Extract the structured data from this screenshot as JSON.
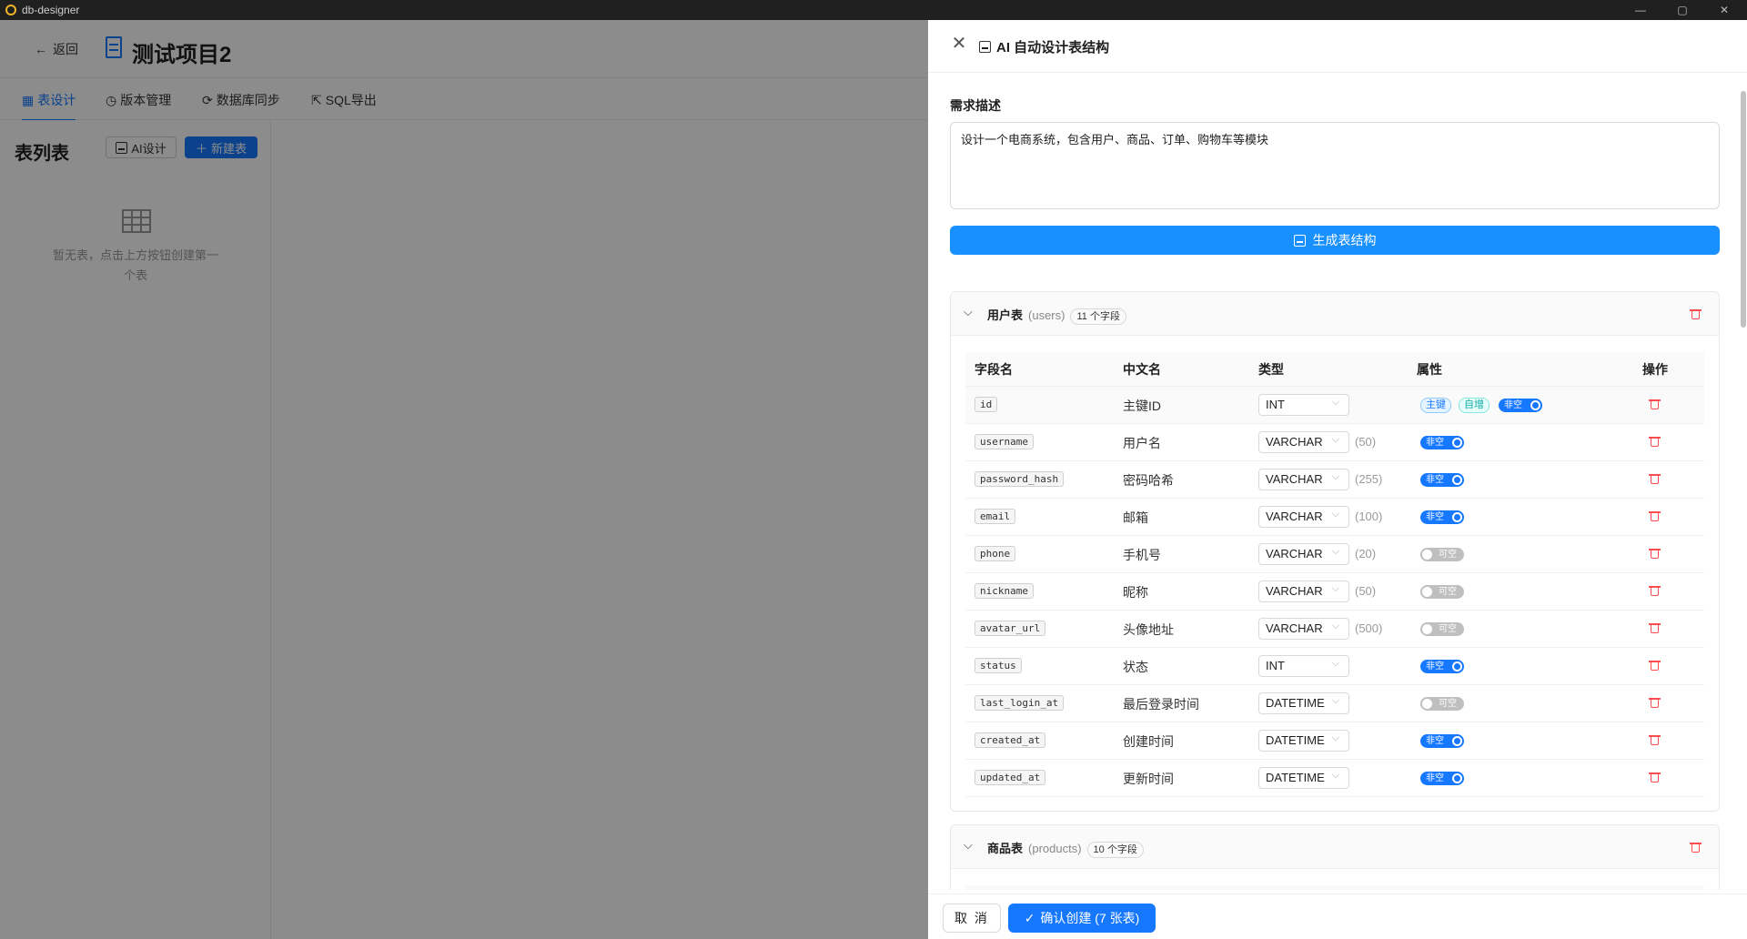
{
  "window": {
    "title": "db-designer",
    "min": "—",
    "max": "▢",
    "close": "✕"
  },
  "header": {
    "back_label": "返回",
    "project_title": "测试项目2"
  },
  "tabs": [
    {
      "label": "表设计",
      "icon": "table-icon"
    },
    {
      "label": "版本管理",
      "icon": "history-icon"
    },
    {
      "label": "数据库同步",
      "icon": "sync-icon"
    },
    {
      "label": "SQL导出",
      "icon": "export-icon"
    }
  ],
  "sidebar": {
    "title": "表列表",
    "ai_button": "AI设计",
    "new_button": "新建表",
    "empty_text": "暂无表，点击上方按钮创建第一个表"
  },
  "drawer": {
    "title": "AI 自动设计表结构",
    "requirement_label": "需求描述",
    "requirement_value": "设计一个电商系统，包含用户、商品、订单、购物车等模块",
    "generate_button": "生成表结构",
    "columns": [
      "字段名",
      "中文名",
      "类型",
      "属性",
      "操作"
    ],
    "tables": [
      {
        "name": "用户表",
        "code": "(users)",
        "count": "11 个字段",
        "fields": [
          {
            "name": "id",
            "cn": "主键ID",
            "type": "INT",
            "len": "",
            "pk": "主键",
            "ai": "自增",
            "nullable": false
          },
          {
            "name": "username",
            "cn": "用户名",
            "type": "VARCHAR",
            "len": "(50)",
            "nullable": false
          },
          {
            "name": "password_hash",
            "cn": "密码哈希",
            "type": "VARCHAR",
            "len": "(255)",
            "nullable": false
          },
          {
            "name": "email",
            "cn": "邮箱",
            "type": "VARCHAR",
            "len": "(100)",
            "nullable": false
          },
          {
            "name": "phone",
            "cn": "手机号",
            "type": "VARCHAR",
            "len": "(20)",
            "nullable": true
          },
          {
            "name": "nickname",
            "cn": "昵称",
            "type": "VARCHAR",
            "len": "(50)",
            "nullable": true
          },
          {
            "name": "avatar_url",
            "cn": "头像地址",
            "type": "VARCHAR",
            "len": "(500)",
            "nullable": true
          },
          {
            "name": "status",
            "cn": "状态",
            "type": "INT",
            "len": "",
            "nullable": false
          },
          {
            "name": "last_login_at",
            "cn": "最后登录时间",
            "type": "DATETIME",
            "len": "",
            "nullable": true
          },
          {
            "name": "created_at",
            "cn": "创建时间",
            "type": "DATETIME",
            "len": "",
            "nullable": false
          },
          {
            "name": "updated_at",
            "cn": "更新时间",
            "type": "DATETIME",
            "len": "",
            "nullable": false
          }
        ]
      },
      {
        "name": "商品表",
        "code": "(products)",
        "count": "10 个字段",
        "fields": []
      }
    ],
    "switch_on": "非空",
    "switch_off": "可空",
    "cancel_button": "取 消",
    "confirm_button": "确认创建 (7 张表)"
  },
  "colors": {
    "primary": "#1677ff",
    "danger": "#ff4d4f",
    "overlay": "rgba(0,0,0,0.45)"
  }
}
